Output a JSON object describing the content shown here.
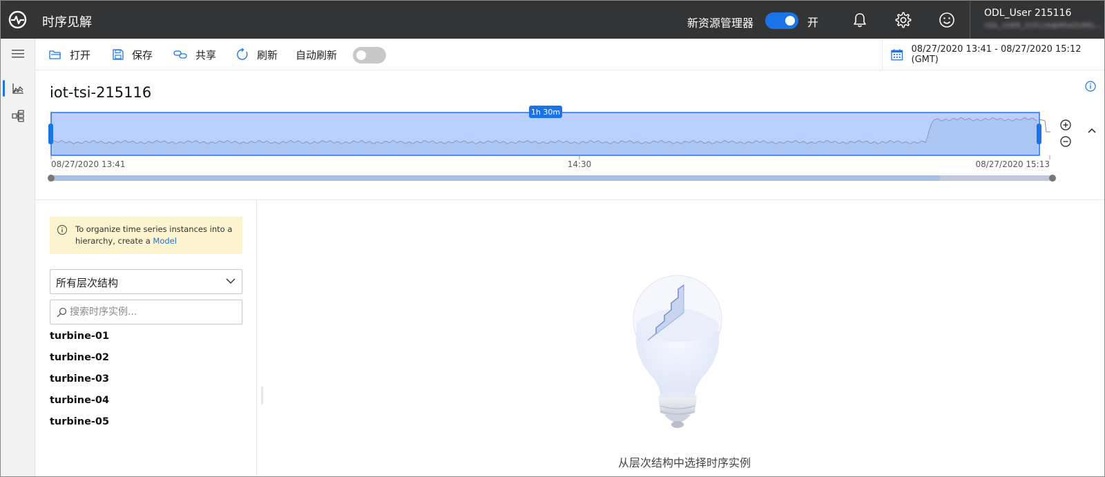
{
  "app": {
    "title": "时序见解"
  },
  "header": {
    "new_explorer_label": "新资源管理器",
    "new_explorer_state": "开",
    "user_name": "ODL_User 215116",
    "user_sub": "ODL_USER_215116@MSAZUREL..."
  },
  "toolbar": {
    "open_label": "打开",
    "save_label": "保存",
    "share_label": "共享",
    "refresh_label": "刷新",
    "auto_refresh_label": "自动刷新",
    "auto_refresh_on": false,
    "date_range": "08/27/2020 13:41 - 08/27/2020 15:12 (GMT)"
  },
  "environment": {
    "name": "iot-tsi-215116"
  },
  "availability": {
    "window_label": "1h 30m",
    "start_label": "08/27/2020 13:41",
    "mid_label": "14:30",
    "end_label": "08/27/2020 15:13"
  },
  "hierarchy": {
    "notice_text": "To organize time series instances into a hierarchy, create a ",
    "notice_link": "Model",
    "select_value": "所有层次结构",
    "search_placeholder": "搜索时序实例...",
    "items": [
      "turbine-01",
      "turbine-02",
      "turbine-03",
      "turbine-04",
      "turbine-05"
    ]
  },
  "empty_state": {
    "caption": "从层次结构中选择时序实例"
  },
  "colors": {
    "accent": "#1a74e8",
    "topbar": "#333436",
    "notice_bg": "#fcf3cf",
    "selection_fill": "#b8d0fb"
  }
}
